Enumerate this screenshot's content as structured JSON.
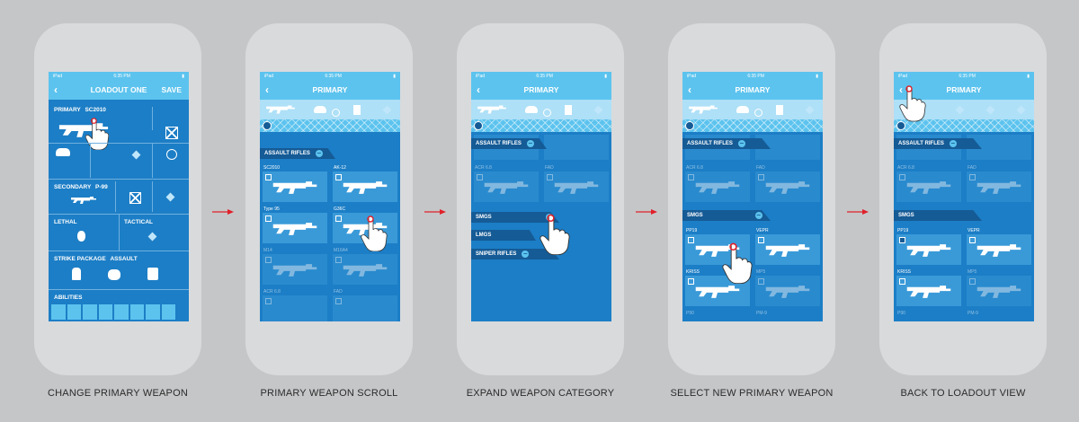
{
  "status_bar": {
    "carrier": "iPad",
    "time": "6:35 PM"
  },
  "screens": [
    {
      "nav_title": "LOADOUT ONE",
      "save_label": "SAVE",
      "primary_label": "PRIMARY",
      "primary_value": "SC2010",
      "secondary_label": "SECONDARY",
      "secondary_value": "P-99",
      "lethal_label": "LETHAL",
      "tactical_label": "TACTICAL",
      "strike_label": "STRIKE PACKAGE",
      "strike_value": "ASSAULT",
      "abilities_label": "ABILITIES",
      "caption": "CHANGE PRIMARY WEAPON"
    },
    {
      "nav_title": "PRIMARY",
      "category": "ASSAULT RIFLES",
      "weapons": [
        "SC2010",
        "AK-12",
        "Type 95",
        "G36C",
        "M14",
        "M16A4",
        "ACR 6.8",
        "FAD"
      ],
      "caption": "PRIMARY WEAPON SCROLL"
    },
    {
      "nav_title": "PRIMARY",
      "category": "ASSAULT RIFLES",
      "weapons": [
        "ACR 6.8",
        "FAD"
      ],
      "categories": [
        "SMGS",
        "LMGS",
        "SNIPER RIFLES"
      ],
      "caption": "EXPAND WEAPON CATEGORY"
    },
    {
      "nav_title": "PRIMARY",
      "category": "ASSAULT RIFLES",
      "weapons": [
        "ACR 6.8",
        "FAD"
      ],
      "category2": "SMGS",
      "smgs": [
        "PP19",
        "VEPR",
        "KRISS",
        "MP5",
        "P90",
        "PM-9"
      ],
      "caption": "SELECT NEW PRIMARY WEAPON"
    },
    {
      "nav_title": "PRIMARY",
      "category": "ASSAULT RIFLES",
      "weapons": [
        "ACR 6.8",
        "FAD"
      ],
      "category2": "SMGS",
      "smgs": [
        "PP19",
        "VEPR",
        "KRISS",
        "MP5",
        "P90",
        "PM-9"
      ],
      "caption": "BACK TO LOADOUT VIEW"
    }
  ],
  "colors": {
    "nav": "#5cc3ee",
    "screen": "#1c7ec6",
    "header": "#155b96",
    "arrow": "#e0202a"
  }
}
